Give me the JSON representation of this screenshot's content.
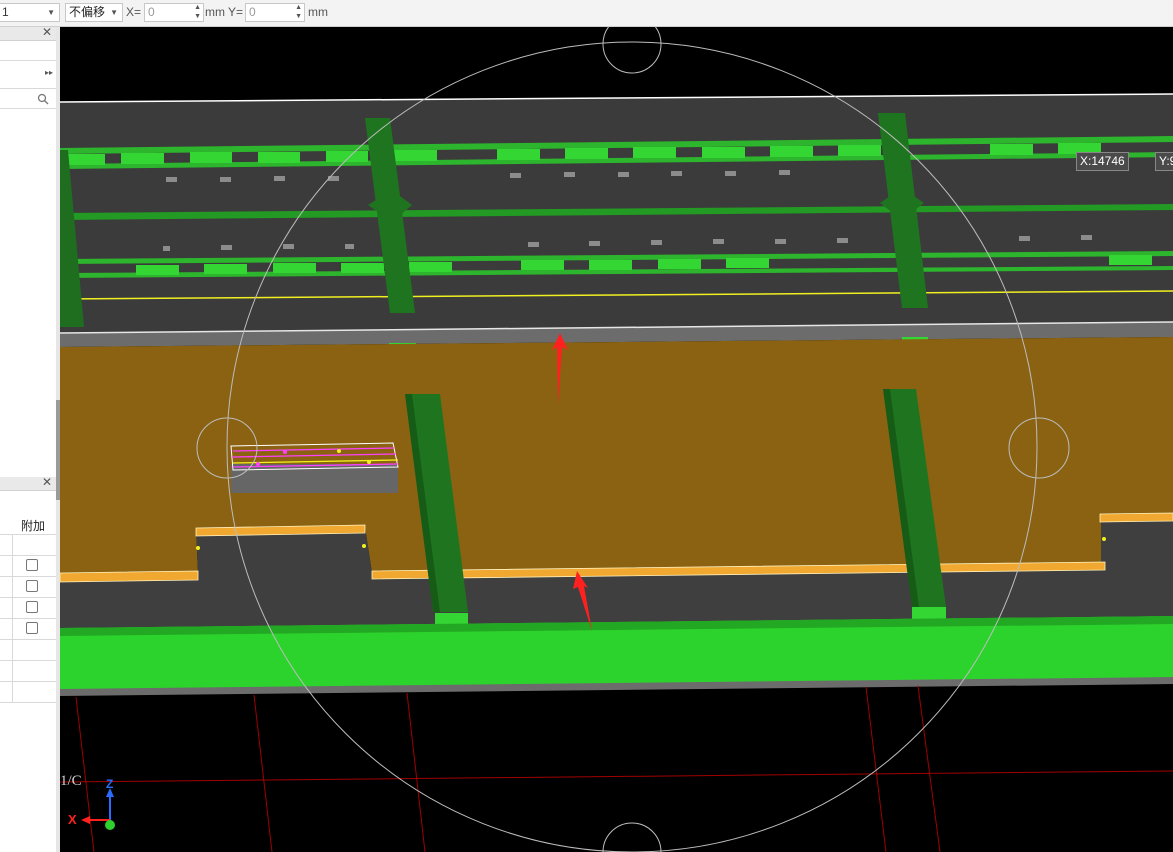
{
  "toolbar": {
    "layer_value": "1",
    "offset_mode": "不偏移",
    "x_label": "X=",
    "x_value": "0",
    "x_unit": "mm",
    "y_label": "Y=",
    "y_value": "0",
    "y_unit": "mm"
  },
  "side_panel": {
    "column_header": "附加",
    "checkbox_rows": [
      false,
      false,
      false,
      false
    ]
  },
  "viewport": {
    "coord_x": "X:14746",
    "coord_y": "Y:9",
    "axis_label": "1/C",
    "axis_z": "Z",
    "axis_x": "X"
  },
  "colors": {
    "slab": "#8a6212",
    "beam_green": "#2bd42b",
    "dark_green": "#1c6e1c",
    "grid_red": "#a00000",
    "arrow_red": "#ff2020"
  },
  "icons": [
    "search-icon",
    "close-icon",
    "expand-arrows-icon",
    "dropdown-arrow-icon",
    "spinner-icon",
    "move-arrow-icon"
  ]
}
